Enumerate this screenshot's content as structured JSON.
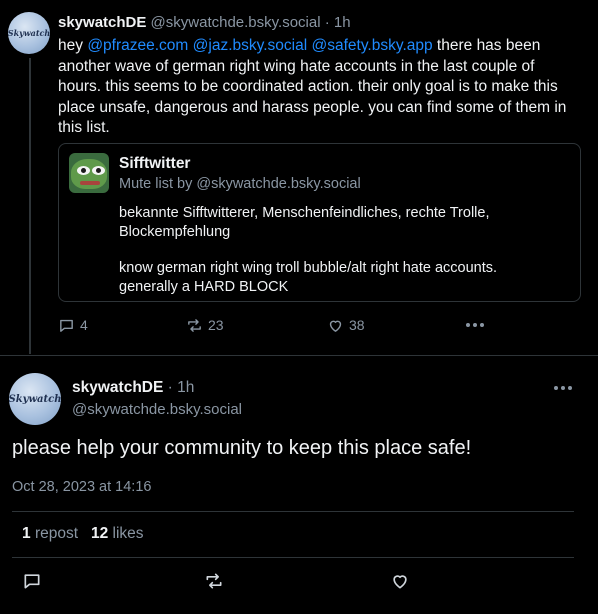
{
  "post1": {
    "avatar_text": "Skywatch",
    "display_name": "skywatchDE",
    "handle": "@skywatchde.bsky.social",
    "separator": "·",
    "time": "1h",
    "text_intro": "hey ",
    "mentions": [
      "@pfrazee.com",
      "@jaz.bsky.social",
      "@safety.bsky.app"
    ],
    "text_body": " there has been another wave of german right wing hate accounts in the last couple of hours. this seems to be coordinated action. their only goal is to make this place unsafe, dangerous and harass people. you can find some of them in this list.",
    "list_card": {
      "title": "Sifftwitter",
      "subtitle": "Mute list by @skywatchde.bsky.social",
      "desc_line1": "bekannte Sifftwitterer, Menschenfeindliches, rechte Trolle, Blockempfehlung",
      "desc_line2": "know german right wing troll bubble/alt right hate accounts. generally a HARD BLOCK"
    },
    "actions": {
      "replies": "4",
      "reposts": "23",
      "likes": "38"
    }
  },
  "post2": {
    "avatar_text": "Skywatch",
    "display_name": "skywatchDE",
    "separator": "·",
    "time": "1h",
    "handle": "@skywatchde.bsky.social",
    "text": "please help your community to keep this place safe!",
    "date": "Oct 28, 2023 at 14:16",
    "repost_count": "1",
    "repost_label": "repost",
    "like_count": "12",
    "like_label": "likes"
  },
  "icons": [
    "reply-icon",
    "repost-icon",
    "like-icon",
    "more-icon"
  ],
  "colors": {
    "background": "#000000",
    "link": "#208bfe",
    "muted": "#8a96a3",
    "border": "#2e3438"
  }
}
